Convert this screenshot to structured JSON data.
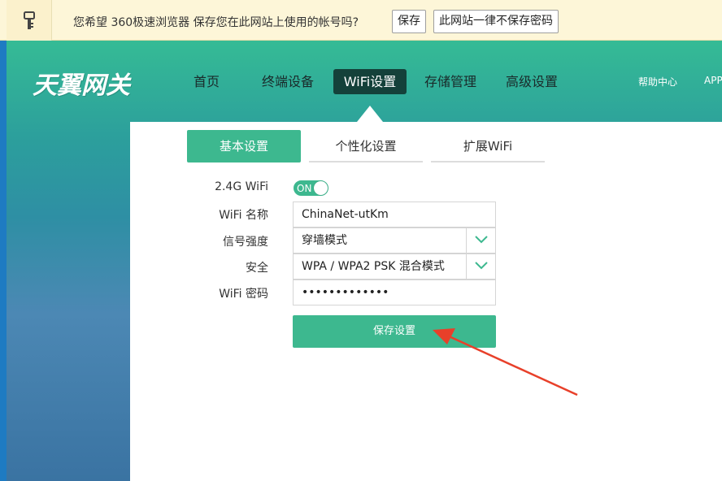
{
  "password_bar": {
    "message": "您希望 360极速浏览器 保存您在此网站上使用的帐号吗?",
    "save_label": "保存",
    "never_label": "此网站一律不保存密码"
  },
  "header": {
    "logo_text": "天翼网关",
    "nav": {
      "home": "首页",
      "devices": "终端设备",
      "wifi": "WiFi设置",
      "storage": "存储管理",
      "advanced": "高级设置",
      "help": "帮助中心",
      "app": "APP"
    }
  },
  "tabs": {
    "basic": "基本设置",
    "personal": "个性化设置",
    "extend": "扩展WiFi"
  },
  "form": {
    "wifi24_label": "2.4G WiFi",
    "wifi24_toggle": "ON",
    "name_label": "WiFi 名称",
    "name_value": "ChinaNet-utKm",
    "signal_label": "信号强度",
    "signal_value": "穿墙模式",
    "security_label": "安全",
    "security_value": "WPA / WPA2 PSK 混合模式",
    "password_label": "WiFi 密码",
    "password_value": "•••••••••••••",
    "save_button": "保存设置"
  },
  "colors": {
    "accent": "#3db88f",
    "nav_active": "#14413a",
    "annotation_arrow": "#e8402a"
  }
}
